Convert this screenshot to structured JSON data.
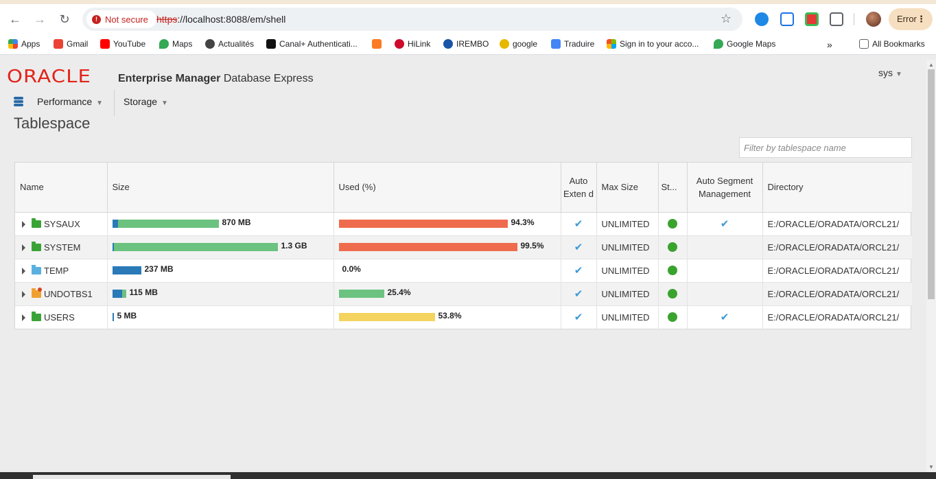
{
  "browser": {
    "not_secure_label": "Not secure",
    "url_scheme": "https",
    "url_rest": "://localhost:8088/em/shell",
    "error_label": "Error",
    "bookmarks": [
      {
        "label": "Apps",
        "icon": "apps-icon",
        "color": "#4285f4"
      },
      {
        "label": "Gmail",
        "icon": "gmail-icon",
        "color": "#ea4335"
      },
      {
        "label": "YouTube",
        "icon": "youtube-icon",
        "color": "#ff0000"
      },
      {
        "label": "Maps",
        "icon": "maps-icon",
        "color": "#34a853"
      },
      {
        "label": "Actualités",
        "icon": "globe-icon",
        "color": "#444444"
      },
      {
        "label": "Canal+ Authenticati...",
        "icon": "canal-plus-icon",
        "color": "#111111"
      },
      {
        "label": "",
        "icon": "xampp-icon",
        "color": "#fb7a24"
      },
      {
        "label": "HiLink",
        "icon": "huawei-icon",
        "color": "#cf0a2c"
      },
      {
        "label": "IREMBO",
        "icon": "irembo-icon",
        "color": "#1a56a8"
      },
      {
        "label": "google",
        "icon": "mw-icon",
        "color": "#e6b800"
      },
      {
        "label": "Traduire",
        "icon": "translate-icon",
        "color": "#4285f4"
      },
      {
        "label": "Sign in to your acco...",
        "icon": "microsoft-icon",
        "color": "#f25022"
      },
      {
        "label": "Google Maps",
        "icon": "google-maps-icon",
        "color": "#34a853"
      }
    ],
    "all_bookmarks_label": "All Bookmarks"
  },
  "header": {
    "logo_text": "ORACLE",
    "product_bold": "Enterprise Manager",
    "product_rest": "Database Express",
    "user": "sys"
  },
  "menu": {
    "performance": "Performance",
    "storage": "Storage"
  },
  "page": {
    "title": "Tablespace",
    "filter_placeholder": "Filter by tablespace name"
  },
  "table": {
    "columns": {
      "name": "Name",
      "size": "Size",
      "used": "Used (%)",
      "auto_extend": "Auto Exten d",
      "max_size": "Max Size",
      "status": "St...",
      "auto_segment": "Auto Segment Management",
      "directory": "Directory"
    },
    "rows": [
      {
        "name": "SYSAUX",
        "type": "permanent",
        "size_label": "870 MB",
        "size_fraction": 0.645,
        "size_used_fraction": 0.05,
        "used_label": "94.3%",
        "used_pct": 94.3,
        "used_color": "#ee6c4d",
        "auto_extend": true,
        "max_size": "UNLIMITED",
        "status": "online",
        "auto_segment": true,
        "directory": "E:/ORACLE/ORADATA/ORCL21/"
      },
      {
        "name": "SYSTEM",
        "type": "permanent",
        "size_label": "1.3 GB",
        "size_fraction": 1.0,
        "size_used_fraction": 0.01,
        "used_label": "99.5%",
        "used_pct": 99.5,
        "used_color": "#ee6c4d",
        "auto_extend": true,
        "max_size": "UNLIMITED",
        "status": "online",
        "auto_segment": false,
        "directory": "E:/ORACLE/ORADATA/ORCL21/"
      },
      {
        "name": "TEMP",
        "type": "temporary",
        "size_label": "237 MB",
        "size_fraction": 0.175,
        "size_used_fraction": 1.0,
        "used_label": "0.0%",
        "used_pct": 0.0,
        "used_color": "#6cc27f",
        "auto_extend": true,
        "max_size": "UNLIMITED",
        "status": "online",
        "auto_segment": false,
        "directory": "E:/ORACLE/ORADATA/ORCL21/"
      },
      {
        "name": "UNDOTBS1",
        "type": "undo",
        "size_label": "115 MB",
        "size_fraction": 0.085,
        "size_used_fraction": 0.72,
        "used_label": "25.4%",
        "used_pct": 25.4,
        "used_color": "#6cc27f",
        "auto_extend": true,
        "max_size": "UNLIMITED",
        "status": "online",
        "auto_segment": false,
        "directory": "E:/ORACLE/ORADATA/ORCL21/"
      },
      {
        "name": "USERS",
        "type": "permanent",
        "size_label": "5 MB",
        "size_fraction": 0.004,
        "size_used_fraction": 1.0,
        "used_label": "53.8%",
        "used_pct": 53.8,
        "used_color": "#f4d35e",
        "auto_extend": true,
        "max_size": "UNLIMITED",
        "status": "online",
        "auto_segment": true,
        "directory": "E:/ORACLE/ORADATA/ORCL21/"
      }
    ]
  },
  "colors": {
    "oracle_red": "#e2231a",
    "size_allocated": "#6cc27f",
    "size_used": "#2a7ab8",
    "status_online": "#3aa32e",
    "check": "#3d9ad6"
  }
}
